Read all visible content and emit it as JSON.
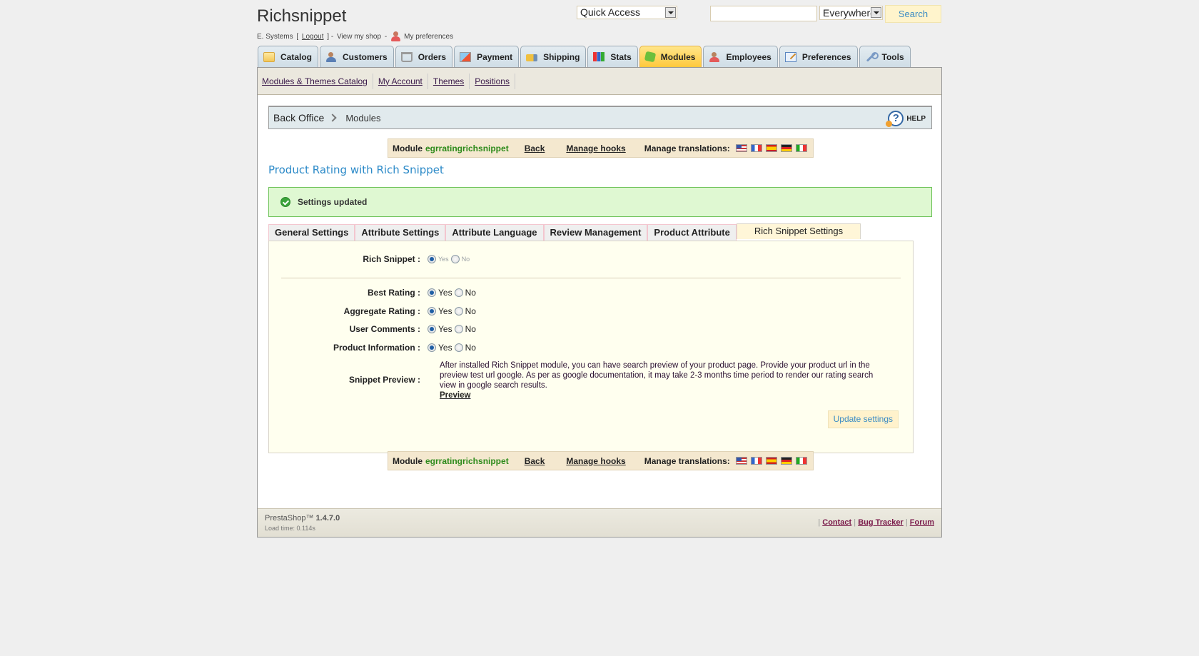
{
  "header": {
    "shop_name": "Richsnippet",
    "user_name": "E. Systems",
    "logout_label": "Logout",
    "view_shop_label": "View my shop",
    "preferences_label": "My preferences",
    "quick_access": "Quick Access",
    "search_value": "",
    "search_scope": "Everywhere",
    "search_button": "Search"
  },
  "tabs": [
    {
      "label": "Catalog",
      "icon": "folder-icon",
      "active": false
    },
    {
      "label": "Customers",
      "icon": "customers-icon",
      "active": false
    },
    {
      "label": "Orders",
      "icon": "cart-icon",
      "active": false
    },
    {
      "label": "Payment",
      "icon": "payment-icon",
      "active": false
    },
    {
      "label": "Shipping",
      "icon": "truck-icon",
      "active": false
    },
    {
      "label": "Stats",
      "icon": "stats-icon",
      "active": false
    },
    {
      "label": "Modules",
      "icon": "puzzle-icon",
      "active": true
    },
    {
      "label": "Employees",
      "icon": "employee-icon",
      "active": false
    },
    {
      "label": "Preferences",
      "icon": "preferences-icon",
      "active": false
    },
    {
      "label": "Tools",
      "icon": "wrench-icon",
      "active": false
    }
  ],
  "submenu": [
    "Modules & Themes Catalog",
    "My Account",
    "Themes",
    "Positions"
  ],
  "breadcrumb": {
    "root": "Back Office",
    "current": "Modules",
    "help_label": "HELP"
  },
  "module_bar": {
    "module_prefix": "Module",
    "module_name": "egrratingrichsnippet",
    "back_label": "Back",
    "hooks_label": "Manage hooks",
    "translations_label": "Manage translations:",
    "flags": [
      "us-flag",
      "fr-flag",
      "es-flag",
      "de-flag",
      "it-flag"
    ]
  },
  "module_title": "Product Rating with Rich Snippet",
  "confirmation": "Settings updated",
  "settings_tabs": [
    {
      "label": "General Settings",
      "active": false
    },
    {
      "label": "Attribute Settings",
      "active": false
    },
    {
      "label": "Attribute Language",
      "active": false
    },
    {
      "label": "Review Management",
      "active": false
    },
    {
      "label": "Product Attribute",
      "active": false
    },
    {
      "label": "Rich Snippet Settings",
      "active": true
    }
  ],
  "form": {
    "rich_snippet": {
      "label": "Rich Snippet :",
      "yes": "Yes",
      "no": "No",
      "value": "yes"
    },
    "fields": [
      {
        "label": "Best Rating :",
        "yes": "Yes",
        "no": "No",
        "value": "yes"
      },
      {
        "label": "Aggregate Rating :",
        "yes": "Yes",
        "no": "No",
        "value": "yes"
      },
      {
        "label": "User Comments :",
        "yes": "Yes",
        "no": "No",
        "value": "yes"
      },
      {
        "label": "Product Information :",
        "yes": "Yes",
        "no": "No",
        "value": "yes"
      }
    ],
    "snippet_preview_label": "Snippet Preview :",
    "snippet_preview_text": "After installed Rich Snippet module, you can have search preview of your product page. Provide your product url in the preview test url google. As per as google documentation, it may take 2-3 months time period to render our rating search view in google search results.",
    "preview_link": "Preview",
    "update_button": "Update settings"
  },
  "footer": {
    "product": "PrestaShop™",
    "version": "1.4.7.0",
    "load_time": "Load time: 0.114s",
    "links": [
      "Contact",
      "Bug Tracker",
      "Forum"
    ]
  }
}
